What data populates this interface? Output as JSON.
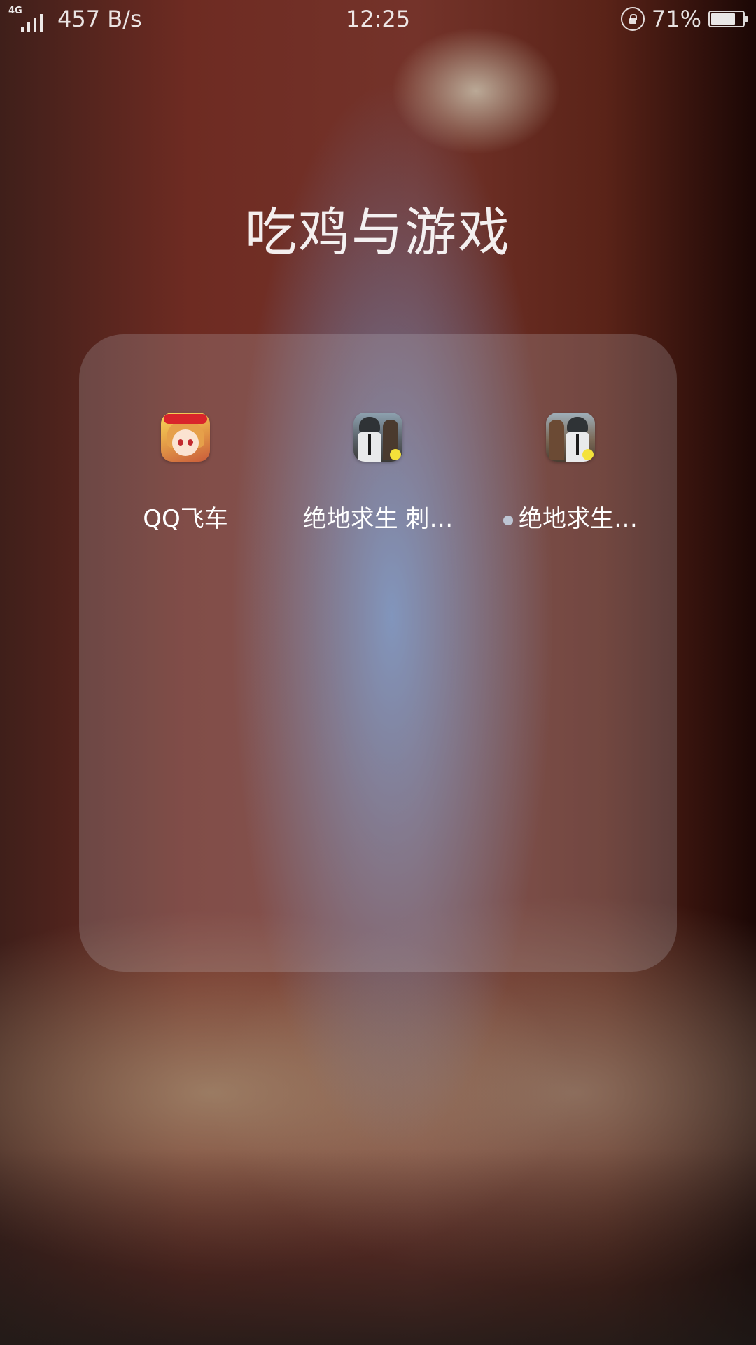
{
  "status_bar": {
    "network_type": "4G",
    "network_speed": "457 B/s",
    "time": "12:25",
    "battery_percent_text": "71%",
    "battery_level": 0.71,
    "icons": [
      "signal-icon",
      "rotation-lock-icon",
      "battery-icon"
    ]
  },
  "folder": {
    "title": "吃鸡与游戏",
    "apps": [
      {
        "label": "QQ飞车",
        "icon": "qq-speed-app-icon",
        "new_indicator": false
      },
      {
        "label": "绝地求生 刺…",
        "icon": "pubg-exhilarating-app-icon",
        "new_indicator": false
      },
      {
        "label": "绝地求生…",
        "icon": "pubg-fullscale-app-icon",
        "new_indicator": true
      }
    ]
  }
}
